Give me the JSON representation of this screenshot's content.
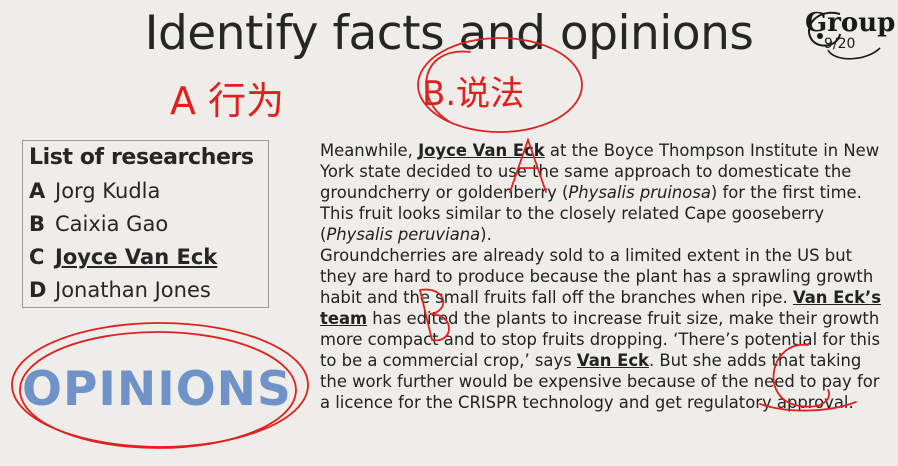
{
  "title": "Identify facts and opinions",
  "logo": {
    "line1": "Group",
    "line2": "9/20"
  },
  "researchers": {
    "heading": "List of researchers",
    "items": [
      {
        "letter": "A",
        "name": "Jorg Kudla",
        "highlight": false
      },
      {
        "letter": "B",
        "name": "Caixia Gao",
        "highlight": false
      },
      {
        "letter": "C",
        "name": "Joyce Van Eck",
        "highlight": true
      },
      {
        "letter": "D",
        "name": "Jonathan Jones",
        "highlight": false
      }
    ]
  },
  "opinions_label": "OPINIONS",
  "handwriting": {
    "a_label": "A 行为",
    "b_label": "B.说法",
    "letter_a": "A",
    "letter_b": "B",
    "letter_c": "C"
  },
  "passage": {
    "p1": {
      "t1": "Meanwhile, ",
      "name": "Joyce Van Eck",
      "t2": " at the Boyce Thompson Institute in New York state decided to use the same approach to domesticate the groundcherry or goldenberry (",
      "sci1": "Physalis pruinosa",
      "t3": ") for the first time. This fruit looks similar to the closely related Cape gooseberry (",
      "sci2": "Physalis peruviana",
      "t4": ")."
    },
    "p2": {
      "t1": "Groundcherries are already sold to a limited extent in the US but they are hard to produce because the plant has a sprawling growth habit and the small fruits fall off the branches when ripe. ",
      "team": "Van Eck’s team",
      "t2": " has edited the plants to increase fruit size, make their growth more compact and to stop fruits dropping. ‘There’s potential for this to be a commercial crop,’ says ",
      "name": "Van Eck",
      "t3": ". But she adds that taking the work further would be expensive because of the need to pay for a licence for the CRISPR technology and get regulatory approval."
    }
  },
  "colors": {
    "ink": "#e0201f",
    "opinions": "#6f93c8",
    "background": "#eeede9"
  }
}
